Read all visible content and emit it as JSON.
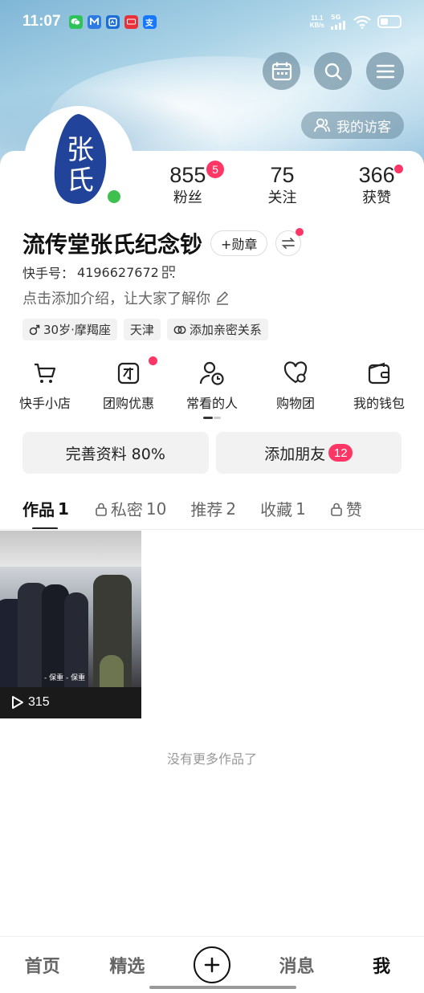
{
  "status_bar": {
    "time": "11:07",
    "net_speed_value": "11.1",
    "net_speed_unit": "KB/s",
    "network": "5G",
    "apps": [
      {
        "icon": "wechat-icon",
        "color": "#2dc35a"
      },
      {
        "icon": "app-m-icon",
        "color": "#2f7be5"
      },
      {
        "icon": "app-square-icon",
        "color": "#1d6fd6"
      },
      {
        "icon": "app-red-icon",
        "color": "#e8313b"
      },
      {
        "icon": "alipay-icon",
        "color": "#1677ff",
        "glyph": "支"
      }
    ]
  },
  "header": {
    "visitor_label": "我的访客"
  },
  "profile": {
    "avatar_text": "张氏",
    "name": "流传堂张氏纪念钞",
    "medal_label": "+勋章",
    "id_label": "快手号：",
    "id_value": "4196627672",
    "bio": "点击添加介绍，让大家了解你",
    "tags": [
      "30岁·摩羯座",
      "天津",
      "添加亲密关系"
    ],
    "online_color": "#3ec04f"
  },
  "stats": [
    {
      "value": "855",
      "label": "粉丝",
      "badge": "5"
    },
    {
      "value": "75",
      "label": "关注"
    },
    {
      "value": "366",
      "label": "获赞",
      "dot": true
    }
  ],
  "shortcuts": [
    {
      "label": "快手小店",
      "icon": "cart-icon"
    },
    {
      "label": "团购优惠",
      "icon": "group-buy-icon",
      "dot": true
    },
    {
      "label": "常看的人",
      "icon": "person-clock-icon"
    },
    {
      "label": "购物团",
      "icon": "heart-group-icon"
    },
    {
      "label": "我的钱包",
      "icon": "wallet-icon"
    }
  ],
  "actions": {
    "complete_profile": "完善资料 80%",
    "add_friends": "添加朋友",
    "add_friends_badge": "12"
  },
  "tabs": [
    {
      "label": "作品",
      "count": "1",
      "locked": false,
      "active": true
    },
    {
      "label": "私密",
      "count": "10",
      "locked": true
    },
    {
      "label": "推荐",
      "count": "2",
      "locked": false
    },
    {
      "label": "收藏",
      "count": "1",
      "locked": false
    },
    {
      "label": "赞",
      "count": "",
      "locked": true
    }
  ],
  "works": [
    {
      "play_count": "315",
      "caption": "- 保重 - 保重"
    }
  ],
  "no_more_text": "没有更多作品了",
  "bottom_nav": {
    "home": "首页",
    "featured": "精选",
    "create": "+",
    "messages": "消息",
    "me": "我"
  },
  "colors": {
    "accent_red": "#fe3666",
    "text_primary": "#222222"
  }
}
